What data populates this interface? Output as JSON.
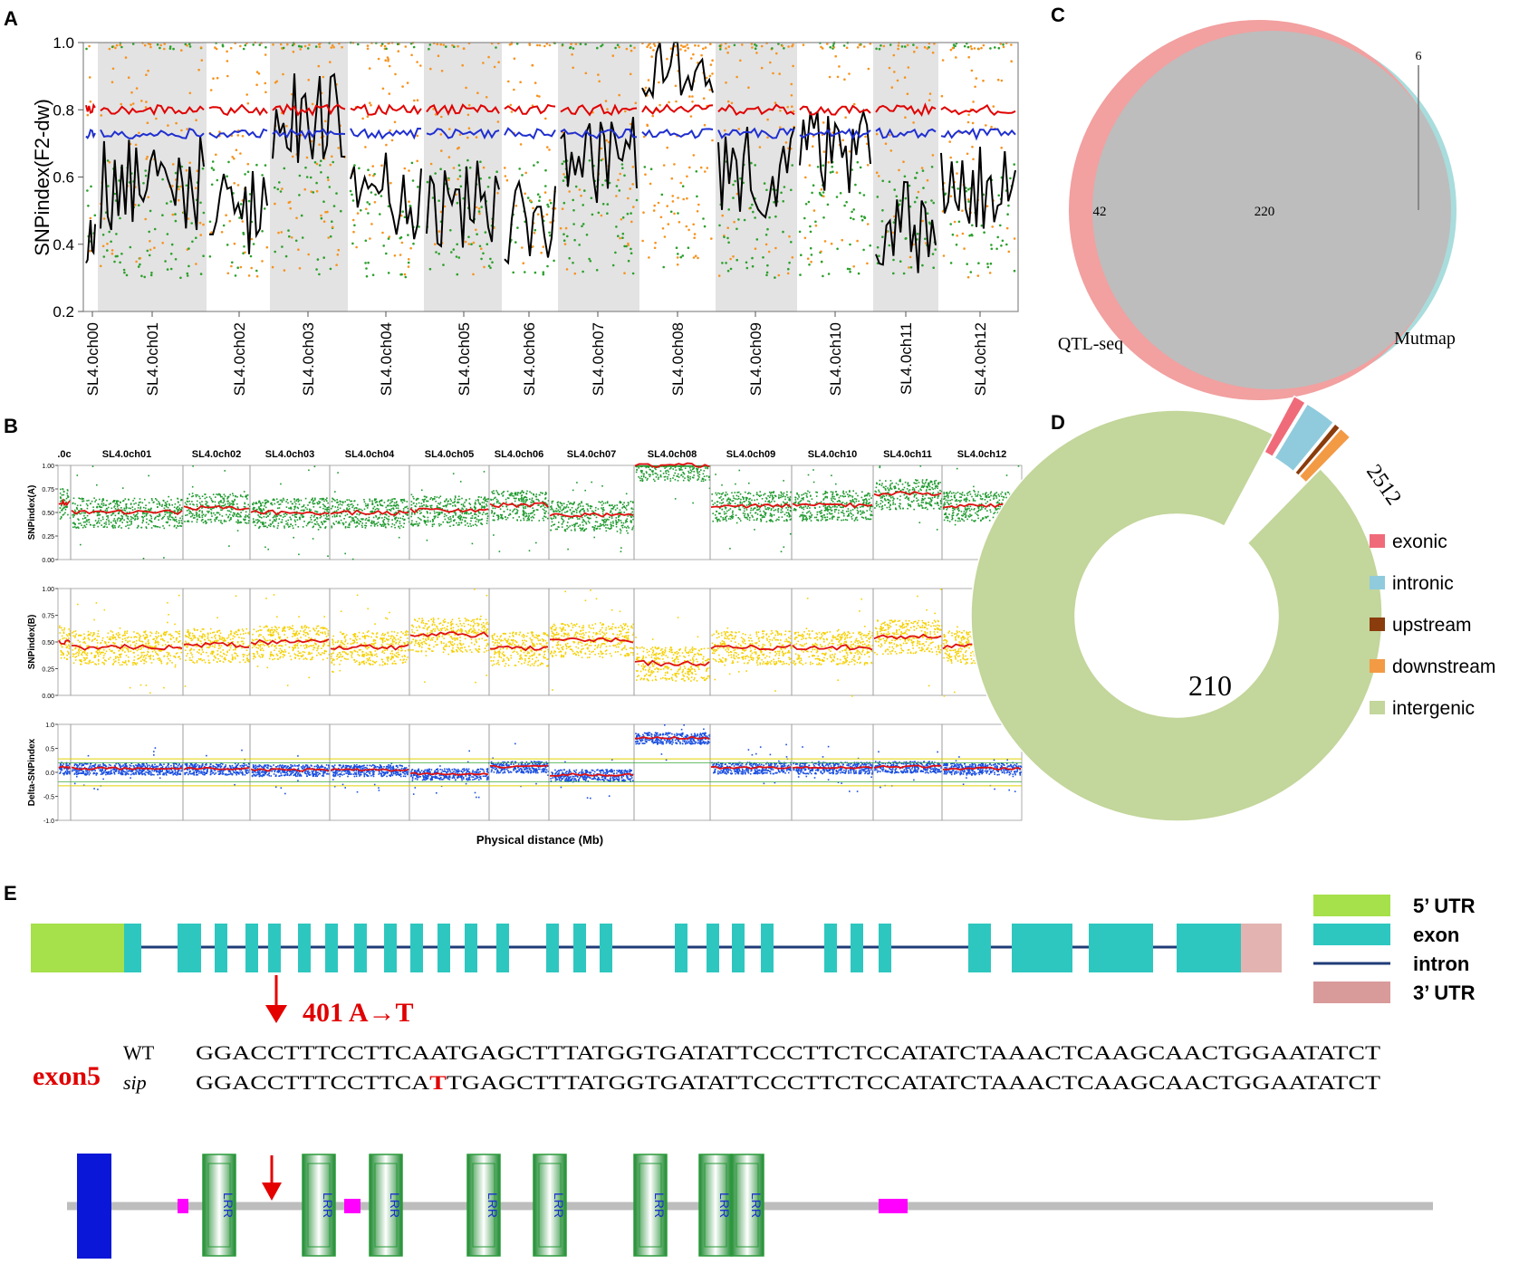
{
  "panels": {
    "A": "A",
    "B": "B",
    "C": "C",
    "D": "D",
    "E": "E"
  },
  "chart_data": [
    {
      "panel": "A",
      "type": "scatter",
      "ylabel": "SNPindex(F2-dw)",
      "ylim": [
        0.2,
        1.0
      ],
      "yticks": [
        "0.2",
        "0.4",
        "0.6",
        "0.8",
        "1.0"
      ],
      "categories": [
        "SL4.0ch00",
        "SL4.0ch01",
        "SL4.0ch02",
        "SL4.0ch03",
        "SL4.0ch04",
        "SL4.0ch05",
        "SL4.0ch06",
        "SL4.0ch07",
        "SL4.0ch08",
        "SL4.0ch09",
        "SL4.0ch10",
        "SL4.0ch11",
        "SL4.0ch12"
      ],
      "colors": {
        "pointsHigh": "#f7931e",
        "pointsLow": "#2ca02c",
        "line": "#000000",
        "threshold99": "#e00000",
        "threshold95": "#1f2fd0",
        "band": "#e3e3e3"
      },
      "thresholds": {
        "upper": 0.8,
        "lower": 0.73
      },
      "chromosome_means": [
        0.38,
        0.58,
        0.5,
        0.78,
        0.55,
        0.53,
        0.48,
        0.66,
        0.92,
        0.62,
        0.66,
        0.45,
        0.58
      ]
    },
    {
      "panel": "B",
      "type": "scatter",
      "chromosomes": [
        ".0c",
        "SL4.0ch01",
        "SL4.0ch02",
        "SL4.0ch03",
        "SL4.0ch04",
        "SL4.0ch05",
        "SL4.0ch06",
        "SL4.0ch07",
        "SL4.0ch08",
        "SL4.0ch09",
        "SL4.0ch10",
        "SL4.0ch11",
        "SL4.0ch12"
      ],
      "xlabel": "Physical distance (Mb)",
      "tracks": [
        {
          "ylabel": "SNPindex(A)",
          "color": "#1e9a2e",
          "yticks": [
            "0.00",
            "0.25",
            "0.50",
            "0.75",
            "1.00"
          ],
          "means": [
            0.6,
            0.5,
            0.55,
            0.5,
            0.5,
            0.52,
            0.58,
            0.47,
            1.0,
            0.57,
            0.58,
            0.7,
            0.57
          ]
        },
        {
          "ylabel": "SNPindex(B)",
          "color": "#f5d000",
          "yticks": [
            "0.00",
            "0.25",
            "0.50",
            "0.75",
            "1.00"
          ],
          "means": [
            0.5,
            0.45,
            0.47,
            0.5,
            0.45,
            0.57,
            0.44,
            0.52,
            0.3,
            0.45,
            0.45,
            0.55,
            0.46
          ]
        },
        {
          "ylabel": "Delta-SNPindex",
          "color": "#1a4fe0",
          "yticks": [
            "-1.0",
            "-0.5",
            "0.0",
            "0.5",
            "1.0"
          ],
          "means": [
            0.1,
            0.08,
            0.08,
            0.05,
            0.05,
            -0.03,
            0.12,
            -0.05,
            0.72,
            0.1,
            0.1,
            0.12,
            0.08
          ]
        }
      ]
    },
    {
      "panel": "C",
      "type": "venn",
      "sets": [
        {
          "name": "QTL-seq",
          "only": "42",
          "color": "#f2a0a0"
        },
        {
          "name": "Mutmap",
          "only": "6",
          "color": "#a9dcdc"
        }
      ],
      "intersection": "220"
    },
    {
      "panel": "D",
      "type": "pie",
      "labels": [
        "exonic",
        "intronic",
        "upstream",
        "downstream",
        "intergenic"
      ],
      "values": [
        2,
        5,
        1,
        2,
        210
      ],
      "colors": [
        "#f06b7a",
        "#8fcbdd",
        "#8b3c0c",
        "#f39a45",
        "#c3d69b"
      ],
      "slice_label_top": "2512",
      "slice_label_main": "210"
    }
  ],
  "gene_model": {
    "legend": [
      {
        "label": "5’ UTR",
        "color": "#a6e04a"
      },
      {
        "label": "exon",
        "color": "#2ec7c0"
      },
      {
        "label": "intron",
        "color": "#1f3c78"
      },
      {
        "label": "3’ UTR",
        "color": "#d99a9a"
      }
    ],
    "mutation_label": "401 A→T",
    "exon_label": "exon5",
    "wt_label": "WT",
    "mut_label": "sip",
    "wt_seq": "GGACCTTTCCTTCAATGAGCTTTATGGTGATATTCCCTTCTCCATATCTAAACTCAAGCAACTGGAATATCT",
    "mut_seq_pre": "GGACCTTTCCTTCA",
    "mut_seq_base": "T",
    "mut_seq_post": "TGAGCTTTATGGTGATATTCCCTTCTCCATATCTAAACTCAAGCAACTGGAATATCT"
  },
  "protein": {
    "lrr_label": "LRR",
    "colors": {
      "signal": "#0a17d8",
      "tm": "#ff00ff",
      "lrr": "#2a9a3a",
      "backbone": "#bdbdbd"
    }
  }
}
